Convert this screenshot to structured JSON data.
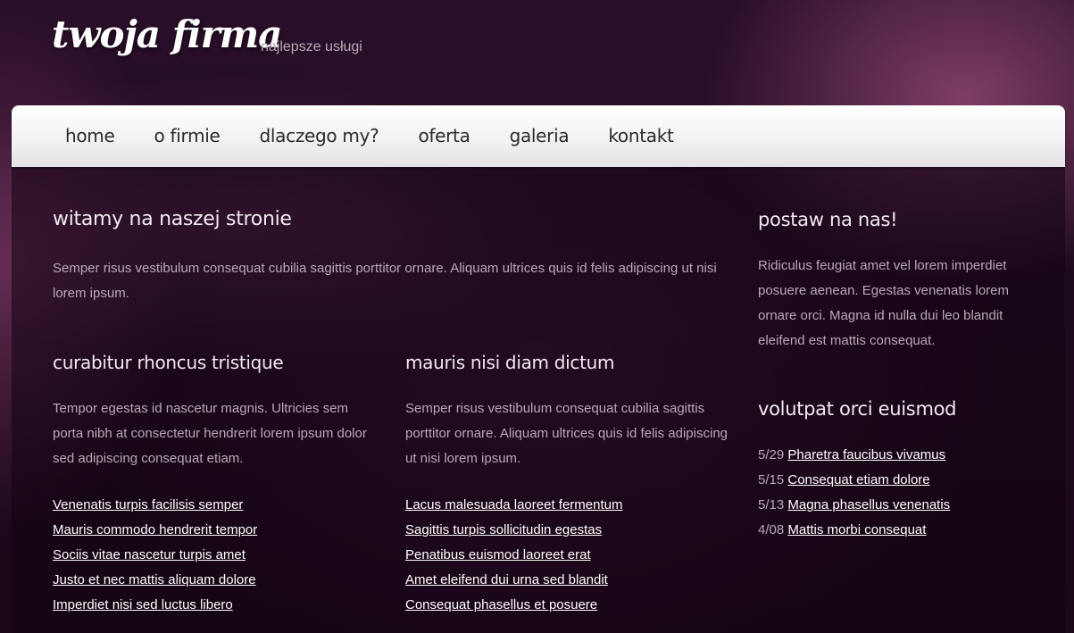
{
  "header": {
    "logo": "twoja firma",
    "tagline": "najlepsze usługi"
  },
  "nav": {
    "items": [
      "home",
      "o firmie",
      "dlaczego my?",
      "oferta",
      "galeria",
      "kontakt"
    ]
  },
  "main": {
    "welcome": {
      "title": "witamy na naszej stronie",
      "text": "Semper risus vestibulum consequat cubilia sagittis porttitor ornare. Aliquam ultrices quis id felis adipiscing ut nisi lorem ipsum."
    },
    "col1": {
      "title": "curabitur rhoncus tristique",
      "text": "Tempor egestas id nascetur magnis. Ultricies sem porta nibh at consectetur hendrerit lorem ipsum dolor sed adipiscing consequat etiam.",
      "links": [
        "Venenatis turpis facilisis semper",
        "Mauris commodo hendrerit tempor",
        "Sociis vitae nascetur turpis amet",
        "Justo et nec mattis aliquam dolore",
        "Imperdiet nisi sed luctus libero"
      ]
    },
    "col2": {
      "title": "mauris nisi diam dictum",
      "text": "Semper risus vestibulum consequat cubilia sagittis porttitor ornare. Aliquam ultrices quis id felis adipiscing ut nisi lorem ipsum.",
      "links": [
        "Lacus malesuada laoreet fermentum",
        "Sagittis turpis sollicitudin egestas",
        "Penatibus euismod laoreet erat",
        "Amet eleifend dui urna sed blandit",
        "Consequat phasellus et posuere"
      ]
    }
  },
  "sidebar": {
    "box1": {
      "title": "postaw na nas!",
      "text": "Ridiculus feugiat amet vel lorem imperdiet posuere aenean. Egestas venenatis lorem ornare orci. Magna id nulla dui leo blandit eleifend est mattis consequat."
    },
    "box2": {
      "title": "volutpat orci euismod",
      "news": [
        {
          "date": "5/29",
          "title": "Pharetra faucibus vivamus"
        },
        {
          "date": "5/15",
          "title": "Consequat etiam dolore"
        },
        {
          "date": "5/13",
          "title": "Magna phasellus venenatis"
        },
        {
          "date": "4/08",
          "title": "Mattis morbi consequat"
        }
      ]
    }
  }
}
